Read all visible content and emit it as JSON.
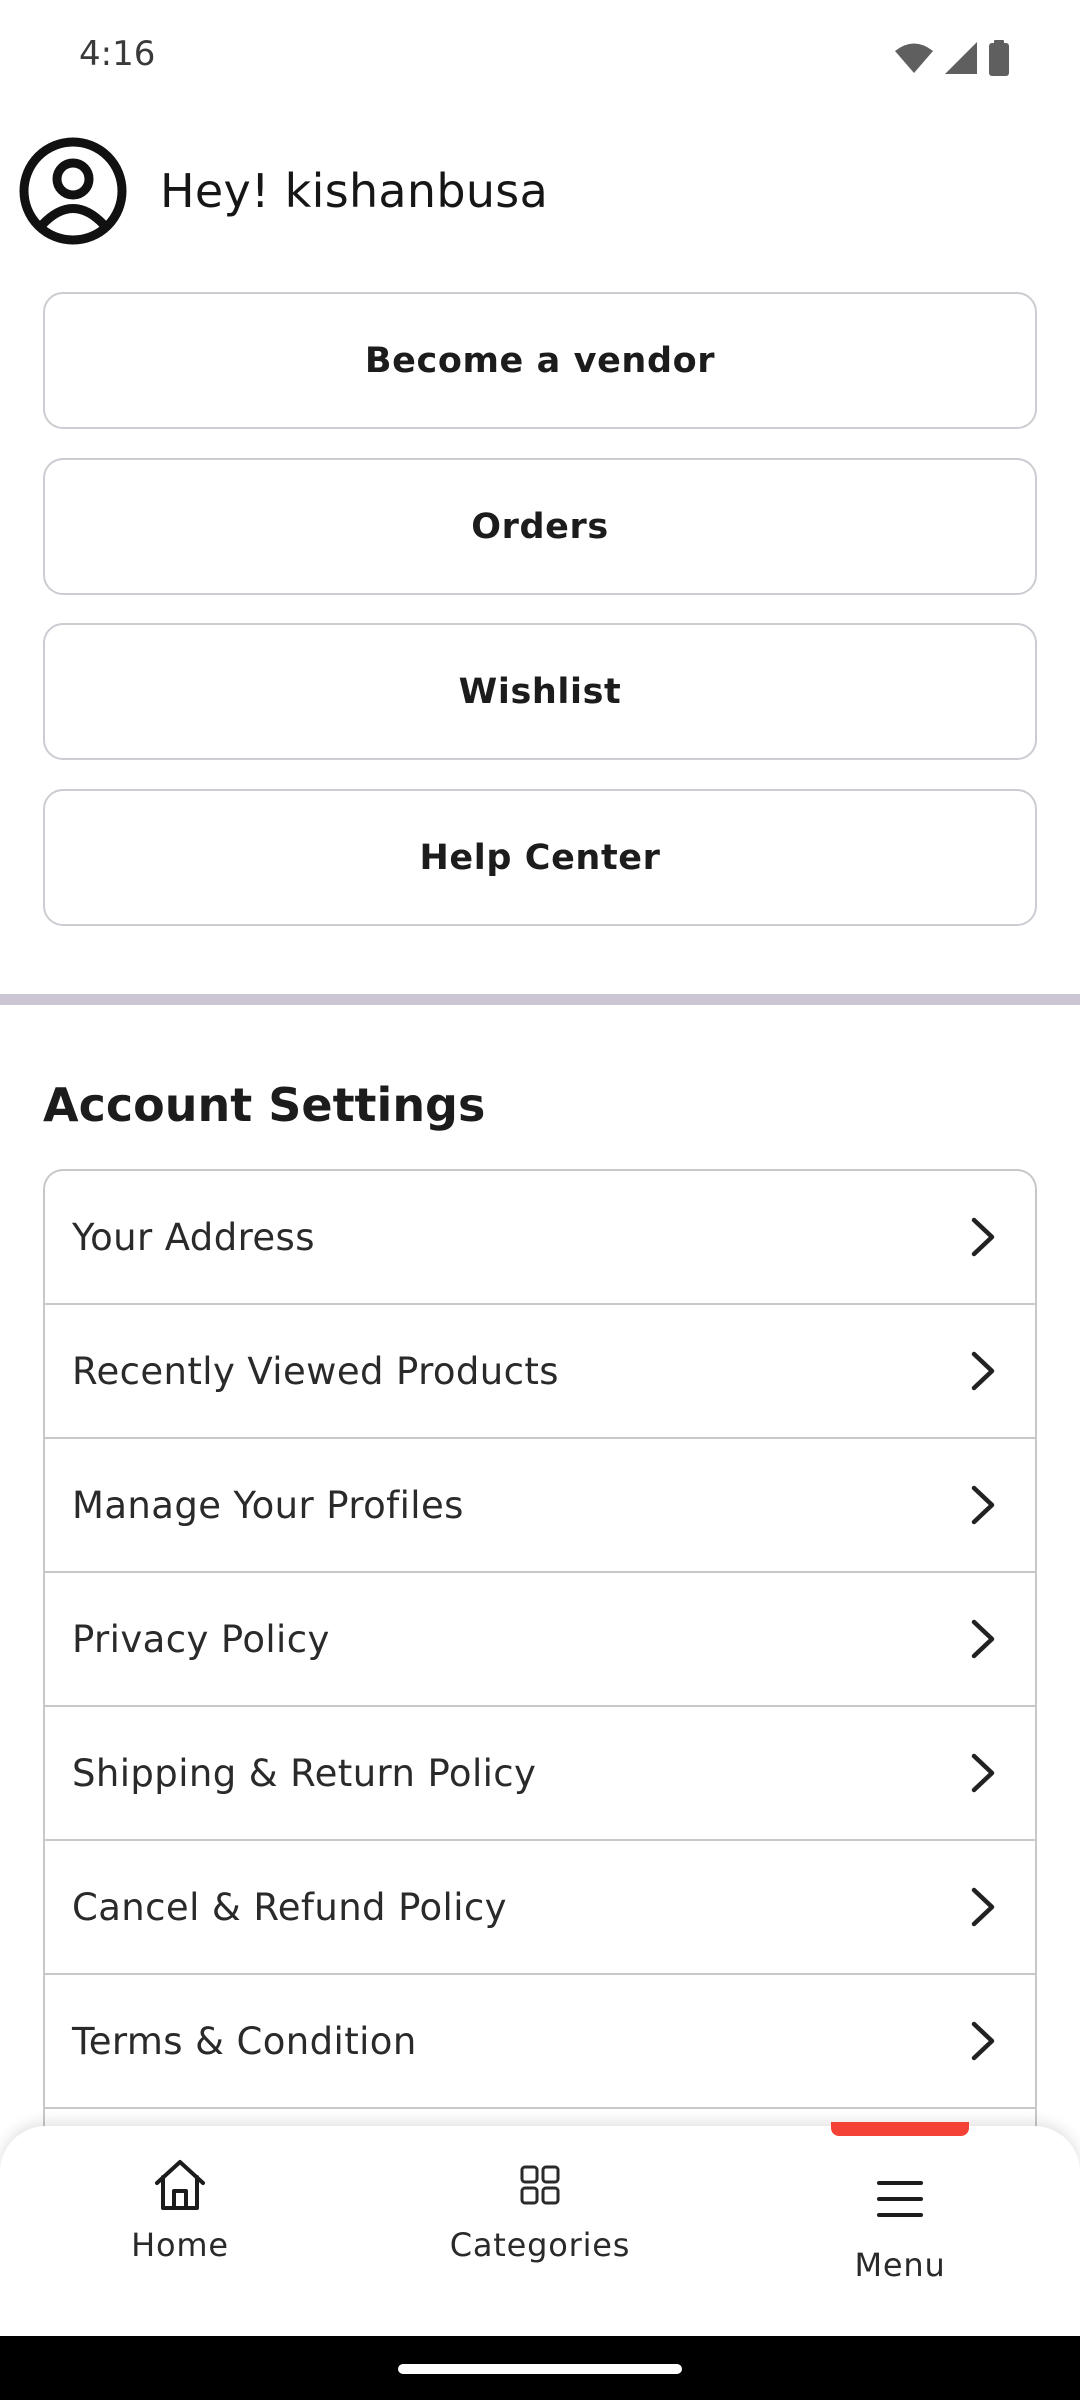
{
  "status_bar": {
    "time": "4:16"
  },
  "header": {
    "greeting": "Hey! kishanbusa"
  },
  "actions": [
    {
      "label": "Become a vendor"
    },
    {
      "label": "Orders"
    },
    {
      "label": "Wishlist"
    },
    {
      "label": "Help Center"
    }
  ],
  "account_settings": {
    "title": "Account Settings",
    "items": [
      {
        "label": "Your Address"
      },
      {
        "label": "Recently Viewed Products"
      },
      {
        "label": "Manage Your Profiles"
      },
      {
        "label": "Privacy Policy"
      },
      {
        "label": "Shipping & Return Policy"
      },
      {
        "label": "Cancel & Refund Policy"
      },
      {
        "label": "Terms & Condition"
      }
    ]
  },
  "bottom_nav": {
    "home": "Home",
    "categories": "Categories",
    "menu": "Menu",
    "active": "menu",
    "accent_color": "#f44336"
  }
}
